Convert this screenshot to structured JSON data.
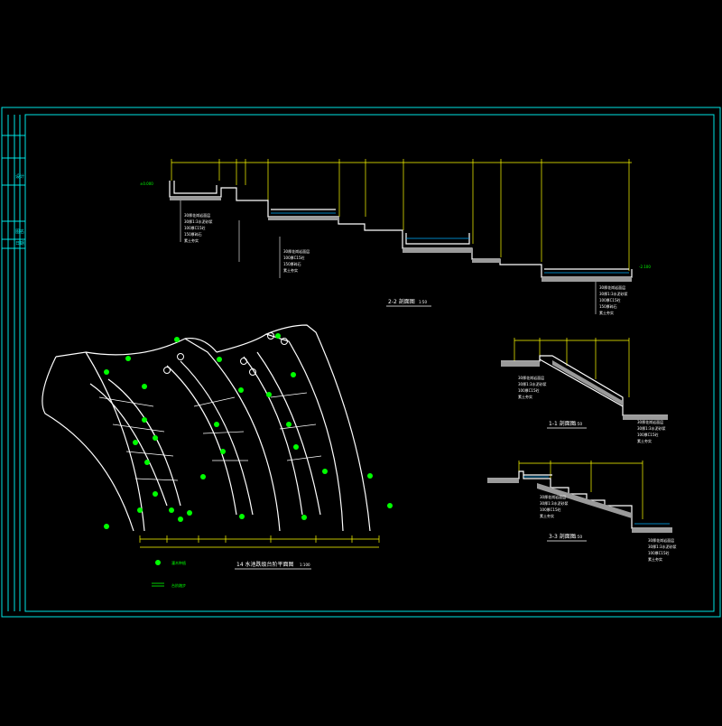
{
  "colors": {
    "background": "#000000",
    "frame": "#00e5e5",
    "line": "#ffffff",
    "accent": "#00ff00",
    "dim": "#ffff00",
    "hatch": "#9a9a9a",
    "water": "#00b0ff"
  },
  "title_strip": {
    "label_a": "设计",
    "label_b": "图名",
    "label_c": "日期"
  },
  "section_top": {
    "title": "2-2 剖面图",
    "scale": "1:50",
    "elev_left": "±0.000",
    "elev_right": "-2.100"
  },
  "section_right_1": {
    "title": "1-1 剖面图",
    "scale": "1:50"
  },
  "section_right_2": {
    "title": "3-3 剖面图",
    "scale": "1:50"
  },
  "plan": {
    "title": "14 水池跌级台阶平面图",
    "scale": "1:100",
    "legend_plant": "灌木种植",
    "legend_step": "台阶踏步"
  },
  "layer_notes": [
    "30厚花岗岩面层",
    "30厚1:3水泥砂浆",
    "100厚C15砼",
    "150厚碎石",
    "素土夯实"
  ],
  "icons": {
    "plant": "shrub-symbol-icon",
    "column": "column-symbol-icon"
  }
}
